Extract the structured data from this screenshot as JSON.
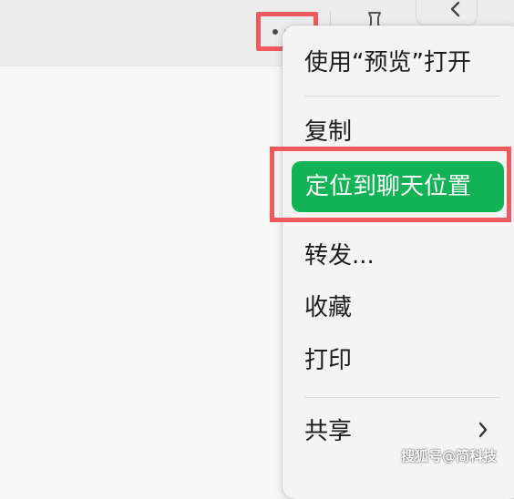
{
  "menu": {
    "items": [
      {
        "label": "使用“预览”打开"
      },
      {
        "label": "复制"
      },
      {
        "label": "定位到聊天位置",
        "highlighted": true
      },
      {
        "label": "转发..."
      },
      {
        "label": "收藏"
      },
      {
        "label": "打印"
      },
      {
        "label": "共享",
        "has_submenu": true
      }
    ]
  },
  "toolbar": {
    "more_icon": "more-horizontal-icon",
    "pin_icon": "pin-icon",
    "back_icon": "chevron-left-icon"
  },
  "watermark": "搜狐号@简科技",
  "colors": {
    "highlight": "#12b257",
    "annotation_border": "#f05a5e",
    "menu_background": "#f4f4f4",
    "toolbar_background": "#ececec"
  }
}
